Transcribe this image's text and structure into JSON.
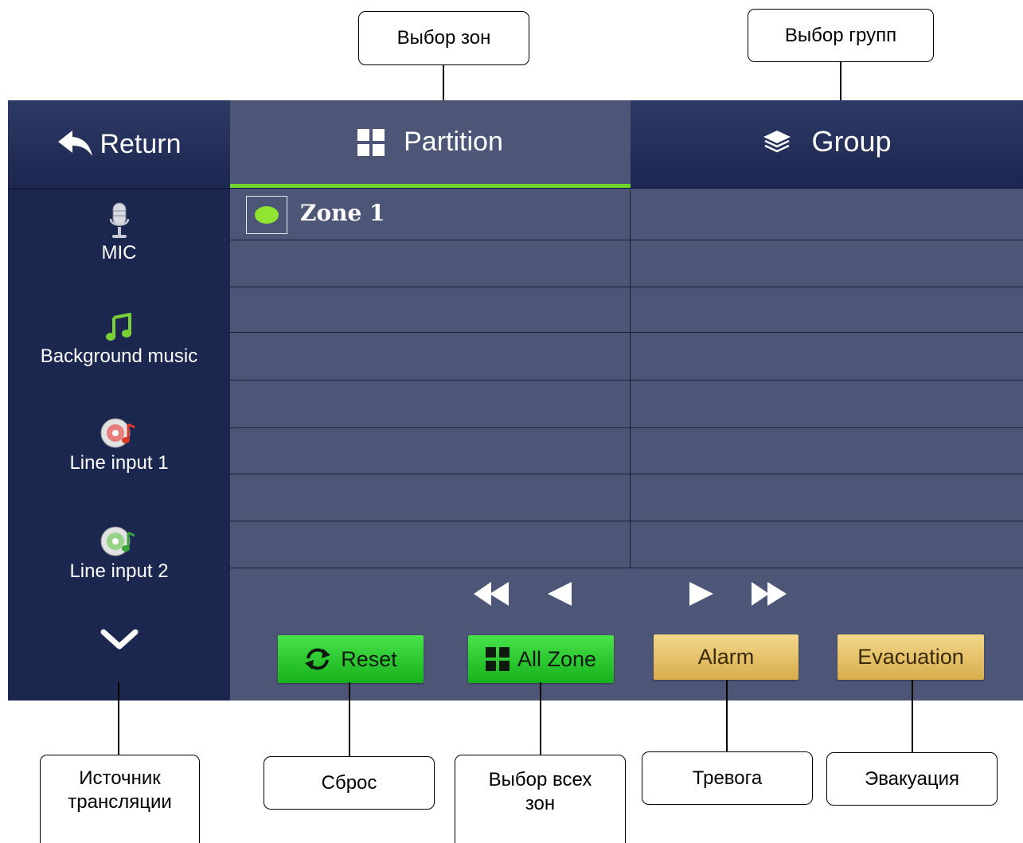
{
  "callouts": {
    "zones_select": "Выбор зон",
    "groups_select": "Выбор групп",
    "source": "Источник\nтрансляции",
    "reset": "Сброс",
    "all_zones": "Выбор всех\nзон",
    "alarm": "Тревога",
    "evacuation": "Эвакуация"
  },
  "header": {
    "return_label": "Return",
    "tab_partition": "Partition",
    "tab_group": "Group",
    "active_tab": "Partition"
  },
  "sources": [
    {
      "label": "MIC",
      "icon": "microphone-icon"
    },
    {
      "label": "Background music",
      "icon": "music-note-icon",
      "color": "#7ad136"
    },
    {
      "label": "Line input 1",
      "icon": "cd-red-icon"
    },
    {
      "label": "Line input 2",
      "icon": "cd-green-icon"
    }
  ],
  "zones": [
    {
      "label": "Zone 1",
      "selected": true
    }
  ],
  "buttons": {
    "reset": "Reset",
    "all_zone": "All Zone",
    "alarm": "Alarm",
    "evacuation": "Evacuation"
  },
  "colors": {
    "accent_green": "#71d42c",
    "panel": "#4e5677",
    "sidebar": "#1c2750"
  }
}
